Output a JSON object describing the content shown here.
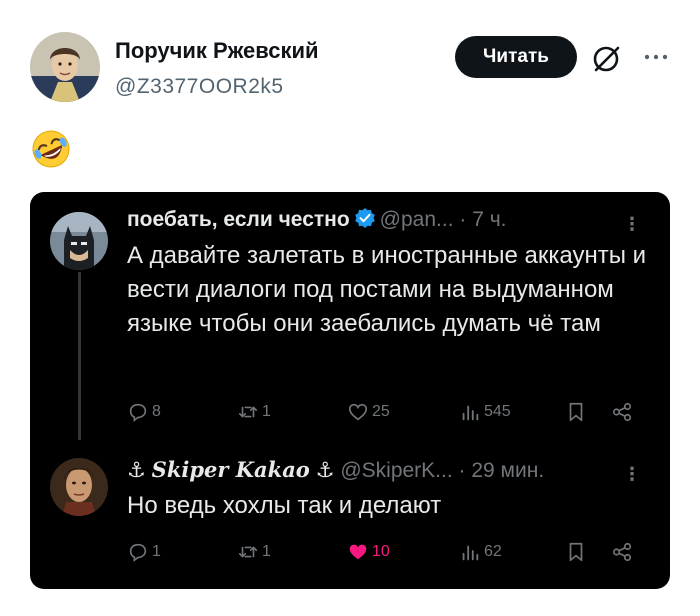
{
  "post": {
    "author_name": "Поручик Ржевский",
    "author_handle": "@Z3377OOR2k5",
    "follow_label": "Читать",
    "emoji": "rolling-on-the-floor-laughing"
  },
  "quote": {
    "tweets": [
      {
        "author_name": "поебать, если честно",
        "verified": true,
        "handle": "@pan...",
        "time": "· 7 ч.",
        "text": "А давайте залетать в иностранные аккаунты и вести диалоги под постами на выдуманном языке чтобы они заебались думать чё там",
        "replies": "8",
        "reposts": "1",
        "likes": "25",
        "views": "545",
        "liked": false
      },
      {
        "author_name": "Skiper Kakao",
        "anchor": "⚓",
        "handle": "@SkiperK...",
        "time": "· 29 мин.",
        "text": "Но ведь хохлы так и делают",
        "replies": "1",
        "reposts": "1",
        "likes": "10",
        "views": "62",
        "liked": true
      }
    ]
  },
  "colors": {
    "card_bg": "#000000",
    "text_primary": "#e7e9ea",
    "text_secondary": "#71767b",
    "like_active": "#f91880",
    "verified_blue": "#1d9bf0",
    "follow_button": "#0f1419"
  }
}
